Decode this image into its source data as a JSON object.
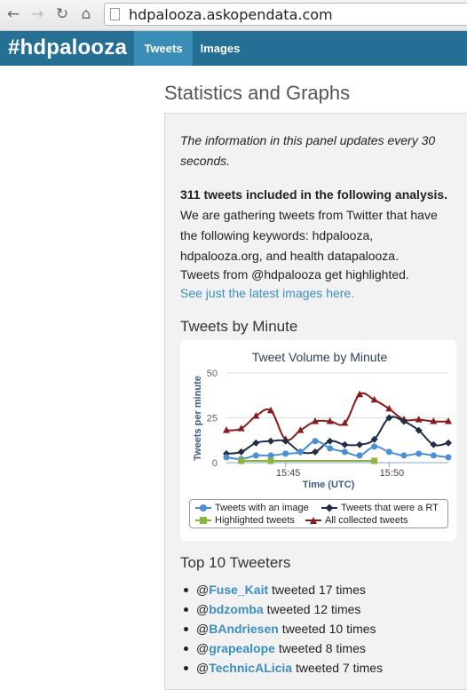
{
  "browser": {
    "url": "hdpalooza.askopendata.com"
  },
  "site": {
    "brand": "#hdpalooza",
    "tabs": [
      {
        "label": "Tweets",
        "active": true
      },
      {
        "label": "Images",
        "active": false
      }
    ]
  },
  "page_title": "Statistics and Graphs",
  "panel": {
    "notice": "The information in this panel updates every 30 seconds.",
    "tweet_count_heading": "311 tweets included in the following analysis.",
    "desc_lines": [
      "We are gathering tweets from Twitter that have",
      "the following keywords: hdpalooza,",
      "hdpalooza.org, and health datapalooza.",
      "Tweets from @hdpalooza get highlighted."
    ],
    "images_link": "See just the latest images here."
  },
  "tweets_by_minute_heading": "Tweets by Minute",
  "chart_data": {
    "type": "line",
    "title": "Tweet Volume by Minute",
    "xlabel": "Time (UTC)",
    "ylabel": "Tweets per minute",
    "ylim": [
      0,
      50
    ],
    "yticks": [
      "0",
      "25",
      "50"
    ],
    "xticks": [
      "15:45",
      "15:50"
    ],
    "x": [
      0,
      1,
      2,
      3,
      4,
      5,
      6,
      7,
      8,
      9,
      10,
      11,
      12,
      13,
      14,
      15
    ],
    "series": [
      {
        "name": "Tweets with an image",
        "color": "#4a8fd4",
        "marker": "circle",
        "values": [
          3,
          2,
          4,
          4,
          5,
          6,
          12,
          8,
          6,
          4,
          9,
          6,
          4,
          5,
          4,
          3
        ]
      },
      {
        "name": "Tweets that were a RT",
        "color": "#1f2f45",
        "marker": "diamond",
        "values": [
          5,
          6,
          11,
          12,
          12,
          6,
          6,
          12,
          10,
          10,
          13,
          25,
          23,
          18,
          10,
          11
        ]
      },
      {
        "name": "Highlighted tweets",
        "color": "#8cb33b",
        "marker": "square",
        "values": [
          1,
          1,
          1,
          1,
          1,
          1,
          1,
          1,
          1,
          1,
          1,
          1,
          1,
          1,
          1,
          1
        ]
      },
      {
        "name": "All collected tweets",
        "color": "#8b1b1b",
        "marker": "triangle",
        "values": [
          18,
          19,
          26,
          29,
          13,
          18,
          23,
          23,
          22,
          38,
          35,
          30,
          24,
          24,
          23,
          23
        ]
      }
    ]
  },
  "top_tweeters_heading": "Top 10 Tweeters",
  "top_tweeters": [
    {
      "handle": "Fuse_Kait",
      "suffix": "tweeted 17 times"
    },
    {
      "handle": "bdzomba",
      "suffix": "tweeted 12 times"
    },
    {
      "handle": "BAndriesen",
      "suffix": "tweeted 10 times"
    },
    {
      "handle": "grapealope",
      "suffix": "tweeted 8 times"
    },
    {
      "handle": "TechnicALicia",
      "suffix": "tweeted 7 times"
    }
  ]
}
